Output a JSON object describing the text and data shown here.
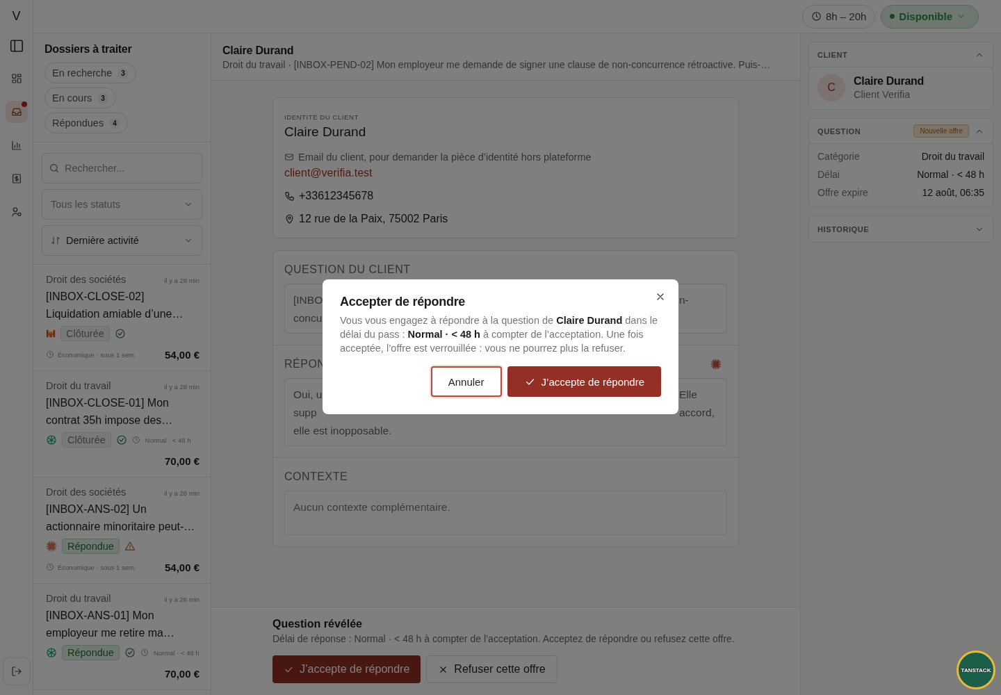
{
  "rail": {
    "logo": "V",
    "items": [
      {
        "selected": false,
        "notification": false
      },
      {
        "selected": true,
        "notification": true
      },
      {
        "selected": false,
        "notification": false
      },
      {
        "selected": false,
        "notification": false
      },
      {
        "selected": false,
        "notification": false
      }
    ]
  },
  "topbar": {
    "hours": "8h – 20h",
    "status": {
      "label": "Disponible"
    }
  },
  "list": {
    "title": "Dossiers à traiter",
    "filters": [
      {
        "label": "En recherche",
        "count": "3"
      },
      {
        "label": "En cours",
        "count": "3"
      },
      {
        "label": "Répondues",
        "count": "4"
      }
    ],
    "search": {
      "placeholder": "Rechercher..."
    },
    "status_select": {
      "placeholder": "Tous les statuts"
    },
    "sort_select": {
      "value": "Dernière activité"
    },
    "cases": [
      {
        "category": "Droit des sociétés",
        "time": "il y a 28 min",
        "title": "[INBOX-CLOSE-02] Liquidation amiable d’une…",
        "provider": {
          "kind": "blocks"
        },
        "status": {
          "label": "Clôturée",
          "kind": "closed"
        },
        "flag": {
          "kind": "check"
        },
        "deadline": {
          "text": "Économique · sous 1 sem.",
          "kind": "footer"
        },
        "price": "54,00 €"
      },
      {
        "category": "Droit du travail",
        "time": "il y a 28 min",
        "title": "[INBOX-CLOSE-01] Mon contrat 35h impose des…",
        "provider": {
          "kind": "knot"
        },
        "status": {
          "label": "Clôturée",
          "kind": "closed"
        },
        "flag": {
          "kind": "check"
        },
        "deadline": {
          "text": "Normal · < 48 h",
          "kind": "inline"
        },
        "price": "70,00 €"
      },
      {
        "category": "Droit des sociétés",
        "time": "il y a 28 min",
        "title": "[INBOX-ANS-02] Un actionnaire minoritaire peut-…",
        "provider": {
          "kind": "burst"
        },
        "status": {
          "label": "Répondue",
          "kind": "answered"
        },
        "flag": {
          "kind": "warning"
        },
        "deadline": {
          "text": "Économique · sous 1 sem.",
          "kind": "footer"
        },
        "price": "54,00 €"
      },
      {
        "category": "Droit du travail",
        "time": "il y a 28 min",
        "title": "[INBOX-ANS-01] Mon employeur me retire ma…",
        "provider": {
          "kind": "knot"
        },
        "status": {
          "label": "Répondue",
          "kind": "answered"
        },
        "flag": {
          "kind": "check"
        },
        "deadline": {
          "text": "Normal · < 48 h",
          "kind": "inline"
        },
        "price": "70,00 €"
      }
    ]
  },
  "main": {
    "title": "Claire Durand",
    "subtitle": "Droit du travail · [INBOX-PEND-02] Mon employeur me demande de signer une clause de non-concurrence rétroactive. Puis-…",
    "identity": {
      "label": "IDENTITÉ DU CLIENT",
      "name": "Claire Durand",
      "email_note": "Email du client, pour demander la pièce d’identité hors plateforme",
      "email": "client@verifia.test",
      "phone": "+33612345678",
      "address": "12 rue de la Paix, 75002 Paris"
    },
    "question": {
      "heading": "QUESTION DU CLIENT",
      "lines": [
        {
          "left": "[INBO",
          "right": "n-"
        },
        {
          "left": "concu"
        }
      ]
    },
    "answer": {
      "heading": "RÉPON",
      "lines": [
        {
          "left": "Oui, u",
          "right": "Elle"
        },
        {
          "left": "supp",
          "right": "accord,"
        },
        {
          "full": "elle est inopposable."
        }
      ]
    },
    "context": {
      "heading": "CONTEXTE",
      "text": "Aucun contexte complémentaire."
    },
    "footer": {
      "title": "Question révélée",
      "text": "Délai de réponse : Normal · < 48 h à compter de l’acceptation. Acceptez de répondre ou refusez cette offre.",
      "accept": "J’accepte de répondre",
      "refuse": "Refuser cette offre"
    }
  },
  "side": {
    "client": {
      "heading": "CLIENT",
      "expanded": true,
      "initial": "C",
      "name": "Claire Durand",
      "subtitle": "Client Verifia"
    },
    "question": {
      "heading": "QUESTION",
      "badge": "Nouvelle offre",
      "expanded": true,
      "rows": [
        {
          "key": "Catégorie",
          "value": "Droit du travail"
        },
        {
          "key": "Délai",
          "value": "Normal · < 48 h"
        },
        {
          "key": "Offre expire",
          "value": "12 août, 06:35"
        }
      ]
    },
    "history": {
      "heading": "HISTORIQUE",
      "expanded": false
    }
  },
  "devtools": {
    "label": "TANSTACK"
  },
  "modal": {
    "title": "Accepter de répondre",
    "text": "Vous vous engagez à répondre à la question de **Claire Durand** dans le délai du pass : **Normal · < 48 h** à compter de l’acceptation. Une fois acceptée, l’offre est verrouillée : vous ne pourrez plus la refuser.",
    "cancel": {
      "label": "Annuler",
      "focused": true
    },
    "confirm": "J’accepte de répondre"
  }
}
